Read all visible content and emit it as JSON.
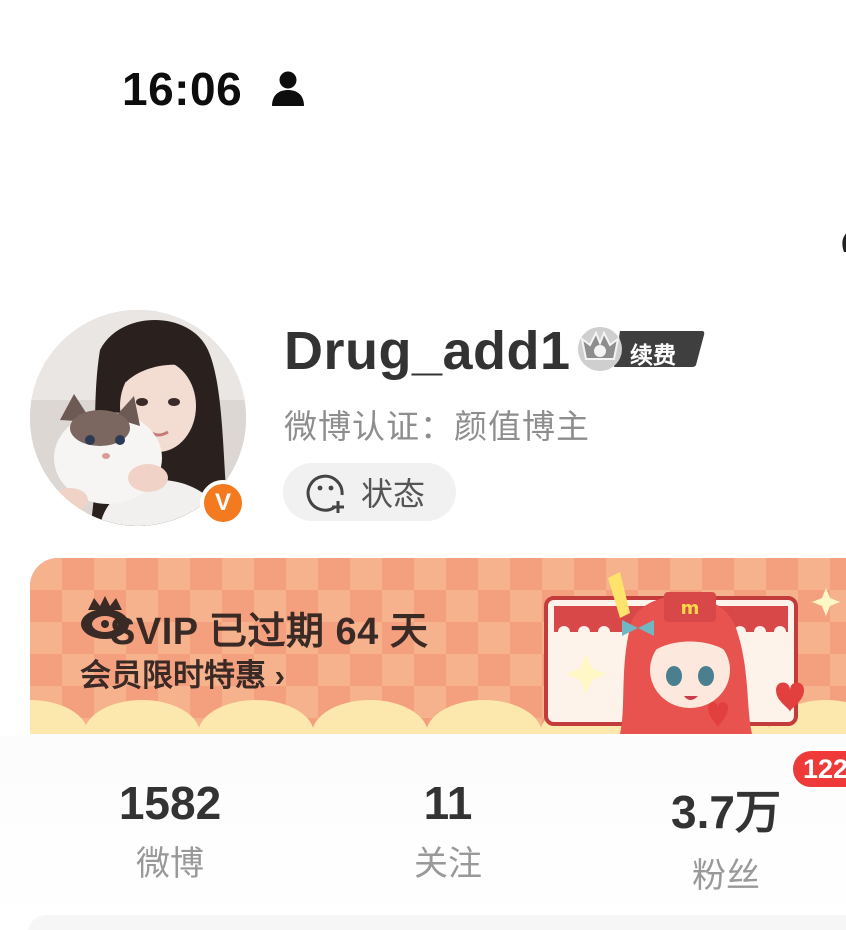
{
  "status_bar": {
    "time": "16:06",
    "person_icon": "person-icon"
  },
  "profile": {
    "username": "Drug_add1",
    "renew_label": "续费",
    "verification": "微博认证：颜值博主",
    "status_button_label": "状态",
    "verified_badge": "V",
    "colors": {
      "verified": "#f47a1f",
      "name": "#333333",
      "subtext": "#8e8e8e"
    }
  },
  "banner": {
    "title": "SVIP 已过期 64 天",
    "subtitle": "会员限时特惠 ›",
    "mascot_icon": "anime-mascot",
    "colors": {
      "bg": "#f4a07f",
      "check": "#f6b892",
      "scallop": "#fce7ad"
    }
  },
  "stats": [
    {
      "value": "1582",
      "label": "微博"
    },
    {
      "value": "11",
      "label": "关注"
    },
    {
      "value": "3.7万",
      "label": "粉丝"
    }
  ],
  "notification_badge": "122",
  "badge_color": "#ef3a3a"
}
